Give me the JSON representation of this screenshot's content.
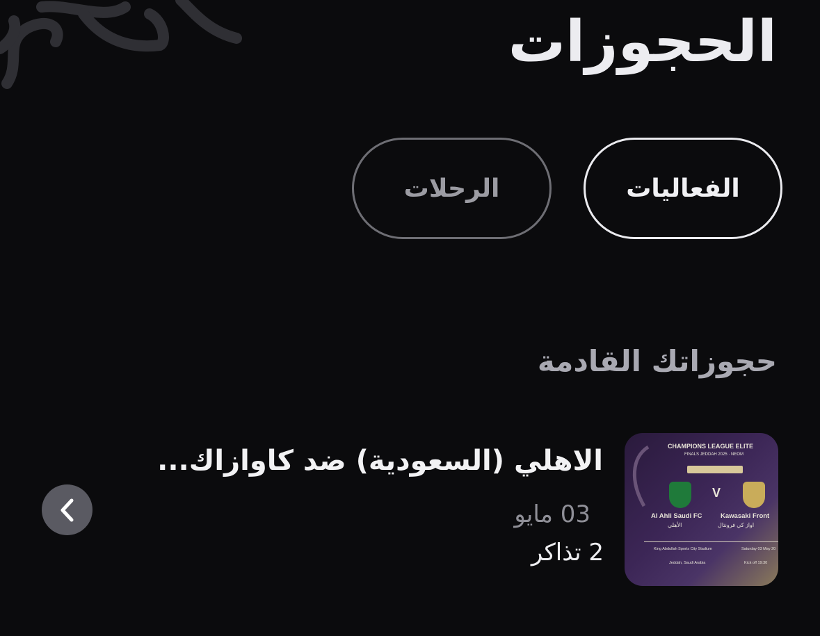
{
  "header": {
    "title": "الحجوزات"
  },
  "tabs": [
    {
      "label": "الفعاليات",
      "active": true
    },
    {
      "label": "الرحلات",
      "active": false
    }
  ],
  "section": {
    "title": "حجوزاتك القادمة"
  },
  "booking": {
    "title": "الاهلي (السعودية) ضد كاوازاك...",
    "date": "03 مايو",
    "tickets": "2 تذاكر",
    "poster": {
      "headline": "CHAMPIONS LEAGUE ELITE",
      "subline": "FINALS JEDDAH 2025 · NEOM",
      "versus": "V",
      "home_team": "Al Ahli Saudi FC",
      "home_team_ar": "الأهلي",
      "away_team": "Kawasaki Front",
      "away_team_ar": "اواز كي فرونتال",
      "venue": "King Abdullah Sports City Stadium",
      "city": "Jeddah, Saudi Arabia",
      "match_date": "Saturday 03 May 20",
      "kickoff": "Kick off 19:30"
    }
  },
  "icons": {
    "nav": "chevron-left-icon",
    "decoration": "swirl-decoration"
  },
  "colors": {
    "background": "#0b0b0d",
    "active_tab_border": "#ebebef",
    "inactive_tab_border": "#6e6e74",
    "nav_button": "#5a5a62"
  }
}
